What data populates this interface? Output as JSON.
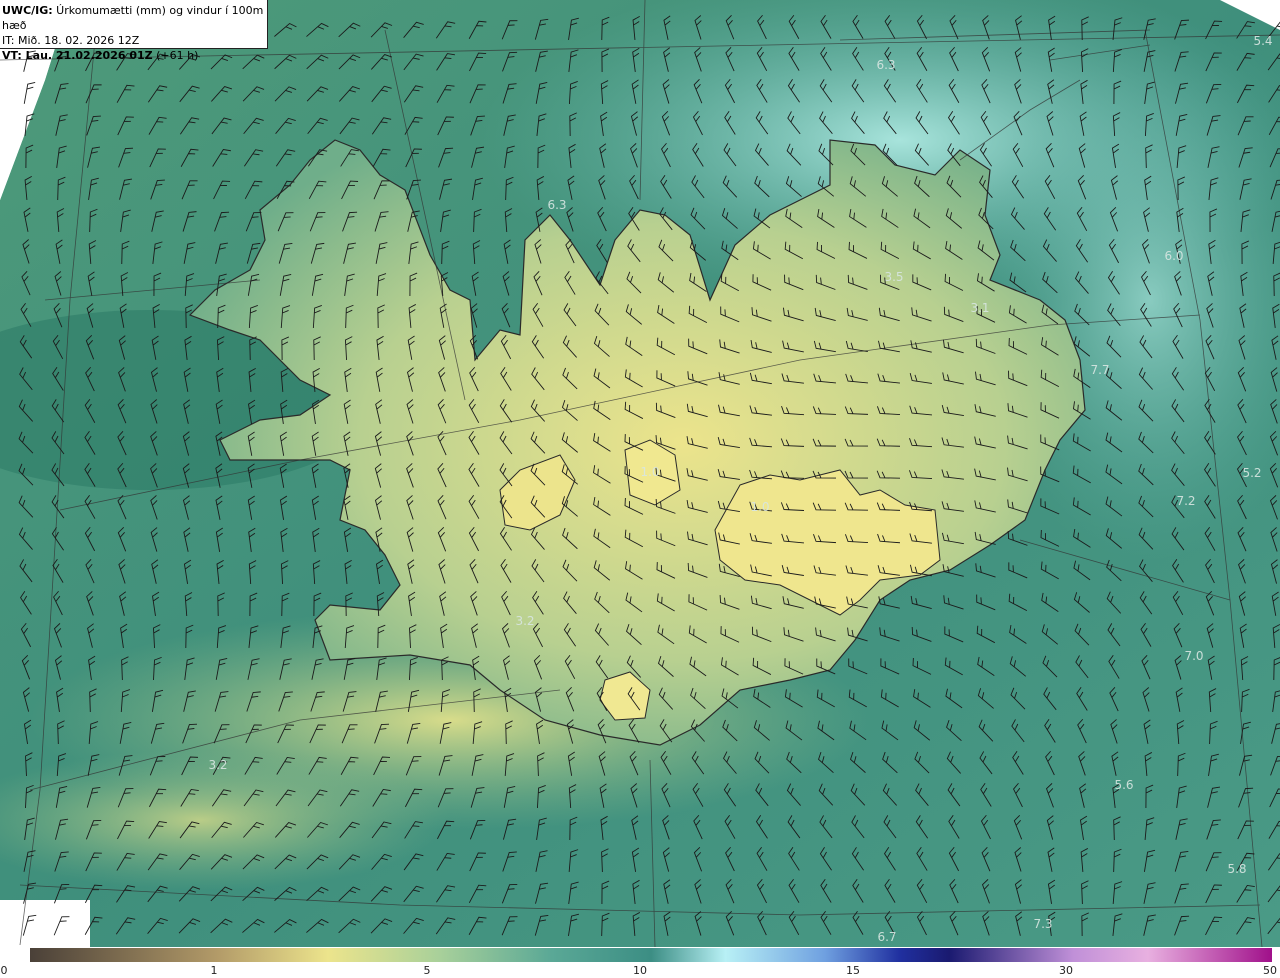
{
  "header": {
    "line1_bold": "UWC/IG:",
    "line1_rest": " Úrkomumætti (mm) og vindur í 100m hæð",
    "line2": "IT: Mið. 18. 02. 2026 12Z",
    "line3_bold": "VT: Lau. 21.02.2026 01Z",
    "line3_rest": " (+61 h)"
  },
  "map_values": [
    "6.3",
    "5.4",
    "6.3",
    "3.5",
    "3.1",
    "6.0",
    "7.7",
    "5.2",
    "7.2",
    "7.0",
    "3.2",
    "3.2",
    "5.6",
    "5.8",
    "7.3",
    "6.7",
    "1.0",
    "1.0"
  ],
  "colorbar": {
    "ticks": [
      "0",
      "1",
      "5",
      "10",
      "15",
      "30",
      "50"
    ],
    "colors": [
      "#4a4038",
      "#a89060",
      "#e8e08a",
      "#7fbfa8",
      "#3a8f80",
      "#bff0f5",
      "#1a1a80",
      "#e0b0e0",
      "#a0208a"
    ]
  },
  "colors": {
    "sea_dark": "#2f7f6f",
    "sea_light": "#7fc8c0",
    "land_light": "#e6e08a",
    "land_mid": "#9fc48a"
  },
  "icons": [
    "wind-barb-icon"
  ]
}
